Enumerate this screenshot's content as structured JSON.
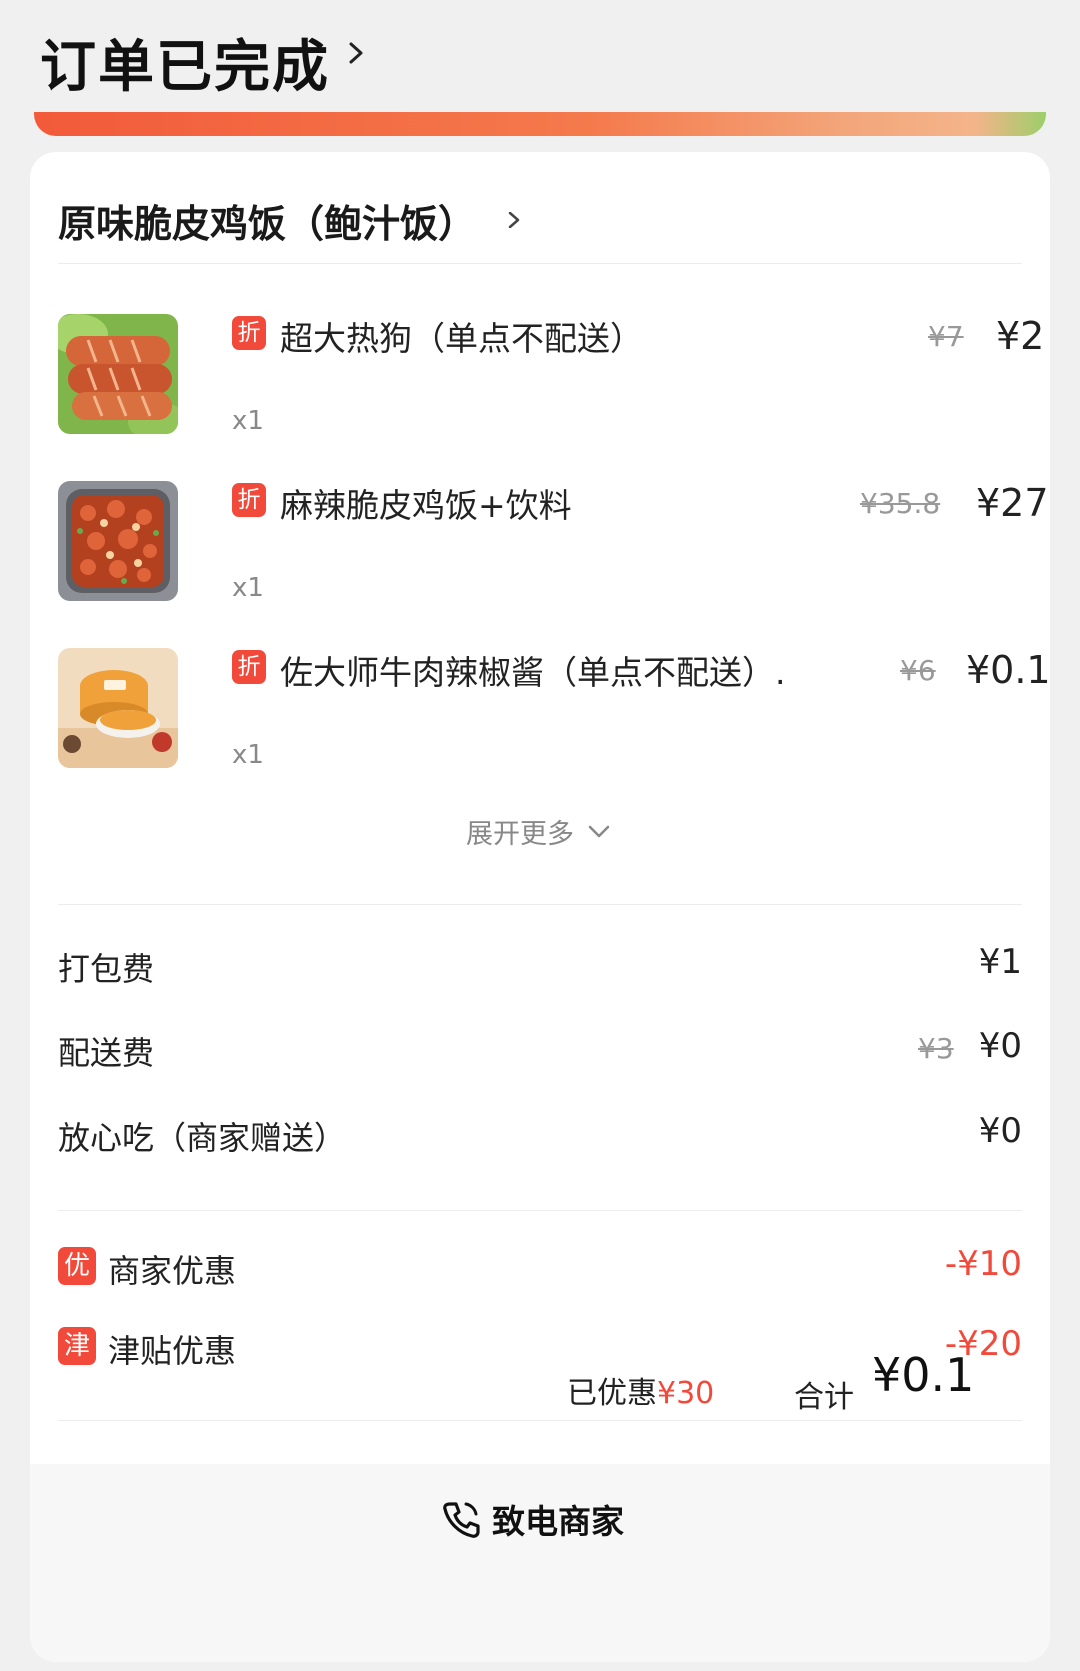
{
  "header": {
    "status_title": "订单已完成"
  },
  "store": {
    "name": "原味脆皮鸡饭（鲍汁饭）"
  },
  "items": [
    {
      "badge": "折",
      "name": "超大热狗（单点不配送）",
      "qty": "x1",
      "original_price": "¥7",
      "price": "¥2"
    },
    {
      "badge": "折",
      "name": "麻辣脆皮鸡饭+饮料",
      "qty": "x1",
      "original_price": "¥35.8",
      "price": "¥27"
    },
    {
      "badge": "折",
      "name": "佐大师牛肉辣椒酱（单点不配送）.",
      "qty": "x1",
      "original_price": "¥6",
      "price": "¥0.1"
    }
  ],
  "expand_more": "展开更多",
  "fees": [
    {
      "label": "打包费",
      "value": "¥1"
    },
    {
      "label": "配送费",
      "original": "¥3",
      "value": "¥0"
    },
    {
      "label": "放心吃（商家赠送）",
      "value": "¥0"
    }
  ],
  "discounts": [
    {
      "badge": "优",
      "label": "商家优惠",
      "value": "-¥10"
    },
    {
      "badge": "津",
      "label": "津贴优惠",
      "value": "-¥20"
    }
  ],
  "summary": {
    "saved_label": "已优惠",
    "saved_value": "¥30",
    "total_label": "合计",
    "total_value": "¥0.1"
  },
  "call": {
    "label": "致电商家"
  },
  "colors": {
    "accent": "#f24a3a",
    "muted": "#999999"
  }
}
